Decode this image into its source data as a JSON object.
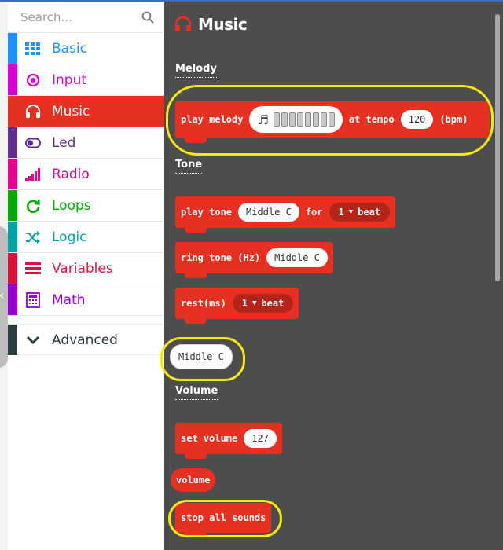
{
  "search": {
    "placeholder": "Search..."
  },
  "sidebar": {
    "items": [
      {
        "label": "Basic",
        "color": "#1e90ff",
        "icon": "grid-icon"
      },
      {
        "label": "Input",
        "color": "#d400d4",
        "icon": "radio-button-icon"
      },
      {
        "label": "Music",
        "color": "#e63022",
        "icon": "headphones-icon",
        "active": true
      },
      {
        "label": "Led",
        "color": "#5c2d91",
        "icon": "toggle-icon"
      },
      {
        "label": "Radio",
        "color": "#e3008c",
        "icon": "signal-bars-icon"
      },
      {
        "label": "Loops",
        "color": "#00aa00",
        "icon": "refresh-icon"
      },
      {
        "label": "Logic",
        "color": "#00a4a6",
        "icon": "shuffle-icon"
      },
      {
        "label": "Variables",
        "color": "#dc143c",
        "icon": "lines-icon"
      },
      {
        "label": "Math",
        "color": "#9400d3",
        "icon": "calculator-icon"
      }
    ],
    "advanced": {
      "label": "Advanced",
      "icon": "chevron-down-icon"
    }
  },
  "flyout": {
    "title": "Music",
    "sections": {
      "melody": "Melody",
      "tone": "Tone",
      "volume": "Volume"
    },
    "blocks": {
      "play_melody": {
        "prefix": "play melody",
        "note_glyph": "♬",
        "mid": "at tempo",
        "tempo": "120",
        "suffix": "(bpm)"
      },
      "play_tone": {
        "prefix": "play tone",
        "note": "Middle C",
        "mid": "for",
        "beat_value": "1",
        "beat_unit": "beat"
      },
      "ring_tone": {
        "prefix": "ring tone (Hz)",
        "note": "Middle C"
      },
      "rest": {
        "prefix": "rest(ms)",
        "beat_value": "1",
        "beat_unit": "beat"
      },
      "note_reporter": {
        "label": "Middle C"
      },
      "set_volume": {
        "prefix": "set volume",
        "value": "127"
      },
      "volume_reporter": {
        "label": "volume"
      },
      "stop_all": {
        "label": "stop all sounds"
      }
    }
  },
  "colors": {
    "music_block": "#e63022",
    "flyout_bg": "#4d4d4d",
    "highlight": "#f5e90c"
  }
}
